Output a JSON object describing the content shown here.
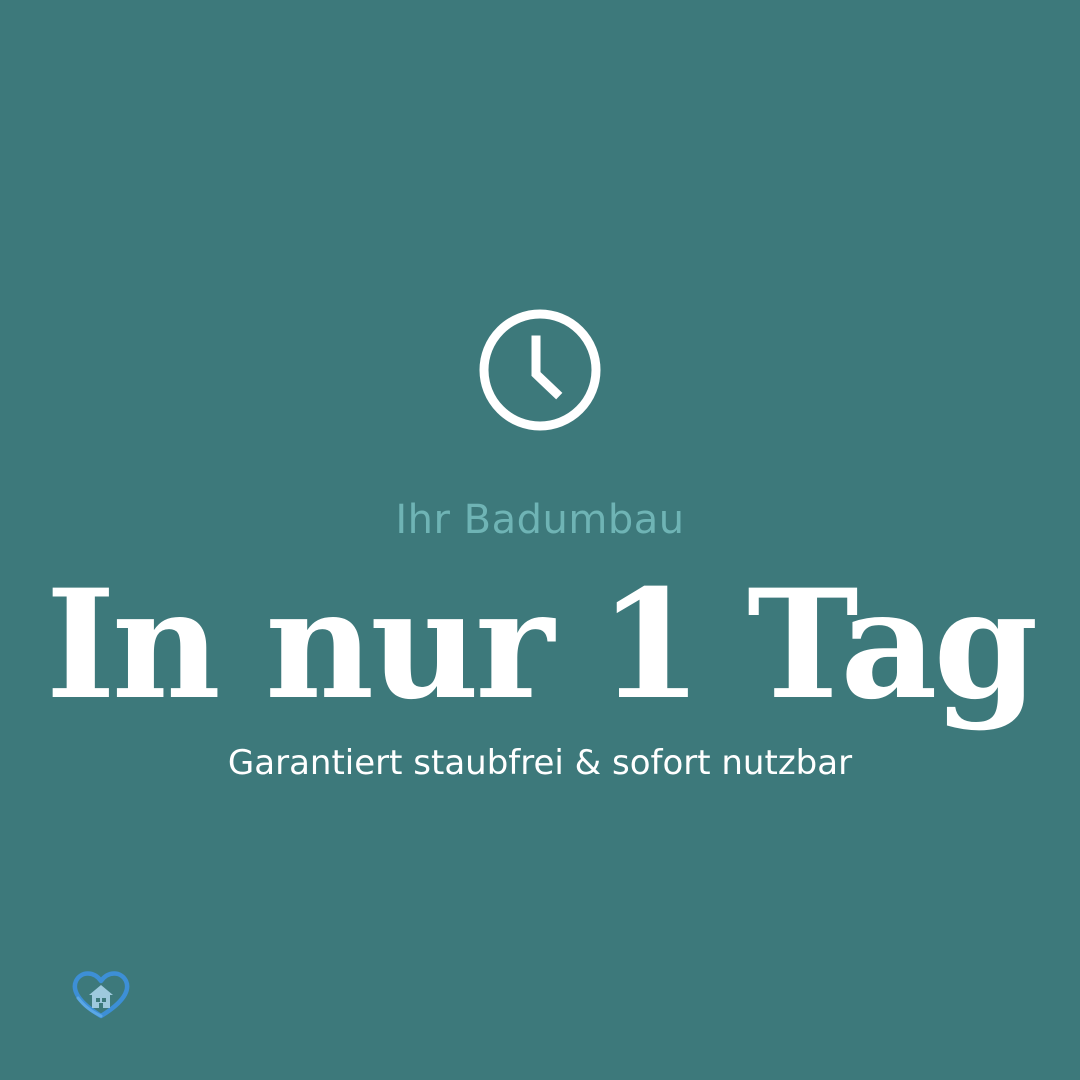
{
  "eyebrow": "Ihr Badumbau",
  "headline": "In nur 1 Tag",
  "subline": "Garantiert staubfrei & sofort nutzbar",
  "icons": {
    "main": "clock-icon",
    "logo": "heart-house-logo"
  },
  "colors": {
    "background": "#3D797B",
    "accent": "#6FB4B5",
    "text": "#FFFFFF",
    "logo_heart": "#3D8FD6",
    "logo_house": "#9EC9DD"
  }
}
